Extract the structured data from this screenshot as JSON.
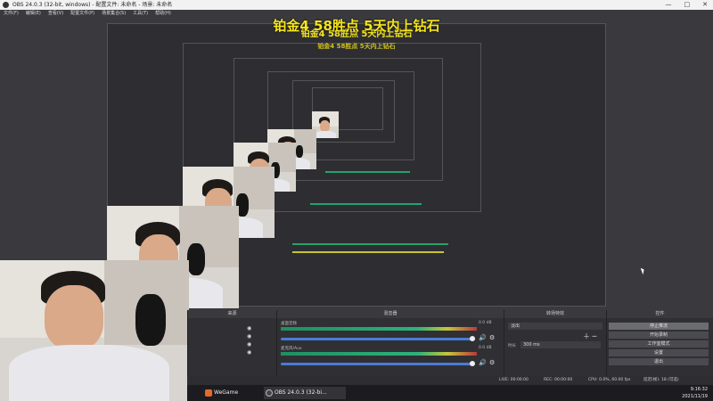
{
  "window": {
    "title": "OBS 24.0.3 (32-bit, windows) - 配置文件: 未命名 - 场景: 未命名",
    "controls": [
      "—",
      "□",
      "✕"
    ]
  },
  "menu": [
    "文件(F)",
    "编辑(E)",
    "查看(V)",
    "配置文件(P)",
    "场景集合(S)",
    "工具(T)",
    "帮助(H)"
  ],
  "overlay_text": "铂金4 58胜点 5天内上钻石",
  "docks": {
    "scenes_header": "来源",
    "mixer_header": "混音器",
    "transitions_header": "转场特效",
    "controls_header": "控件",
    "mixer_tracks": [
      {
        "name": "桌面音频",
        "db": "0.0 dB"
      },
      {
        "name": "麦克风/Aux",
        "db": "0.0 dB"
      }
    ],
    "transition": {
      "type": "淡出",
      "duration_label": "时长",
      "duration_value": "300 ms"
    },
    "controls": [
      "停止推流",
      "开始录制",
      "工作室模式",
      "设置",
      "退出"
    ]
  },
  "status": {
    "left": "LIVE: 00:00:00",
    "rec": "REC: 00:00:00",
    "cpu": "CPU: 0.0%, 60.00 fps",
    "fps": "延迟(帧): 18 (可选)"
  },
  "taskbar": {
    "apps": [
      "WeGame",
      "OBS 24.0.3 (32-bi..."
    ],
    "time": "9:16:32",
    "date": "2021/11/19"
  },
  "colors": {
    "accent": "#f5e51c",
    "meter_green": "#2db37a",
    "slider": "#4a7bd6"
  }
}
